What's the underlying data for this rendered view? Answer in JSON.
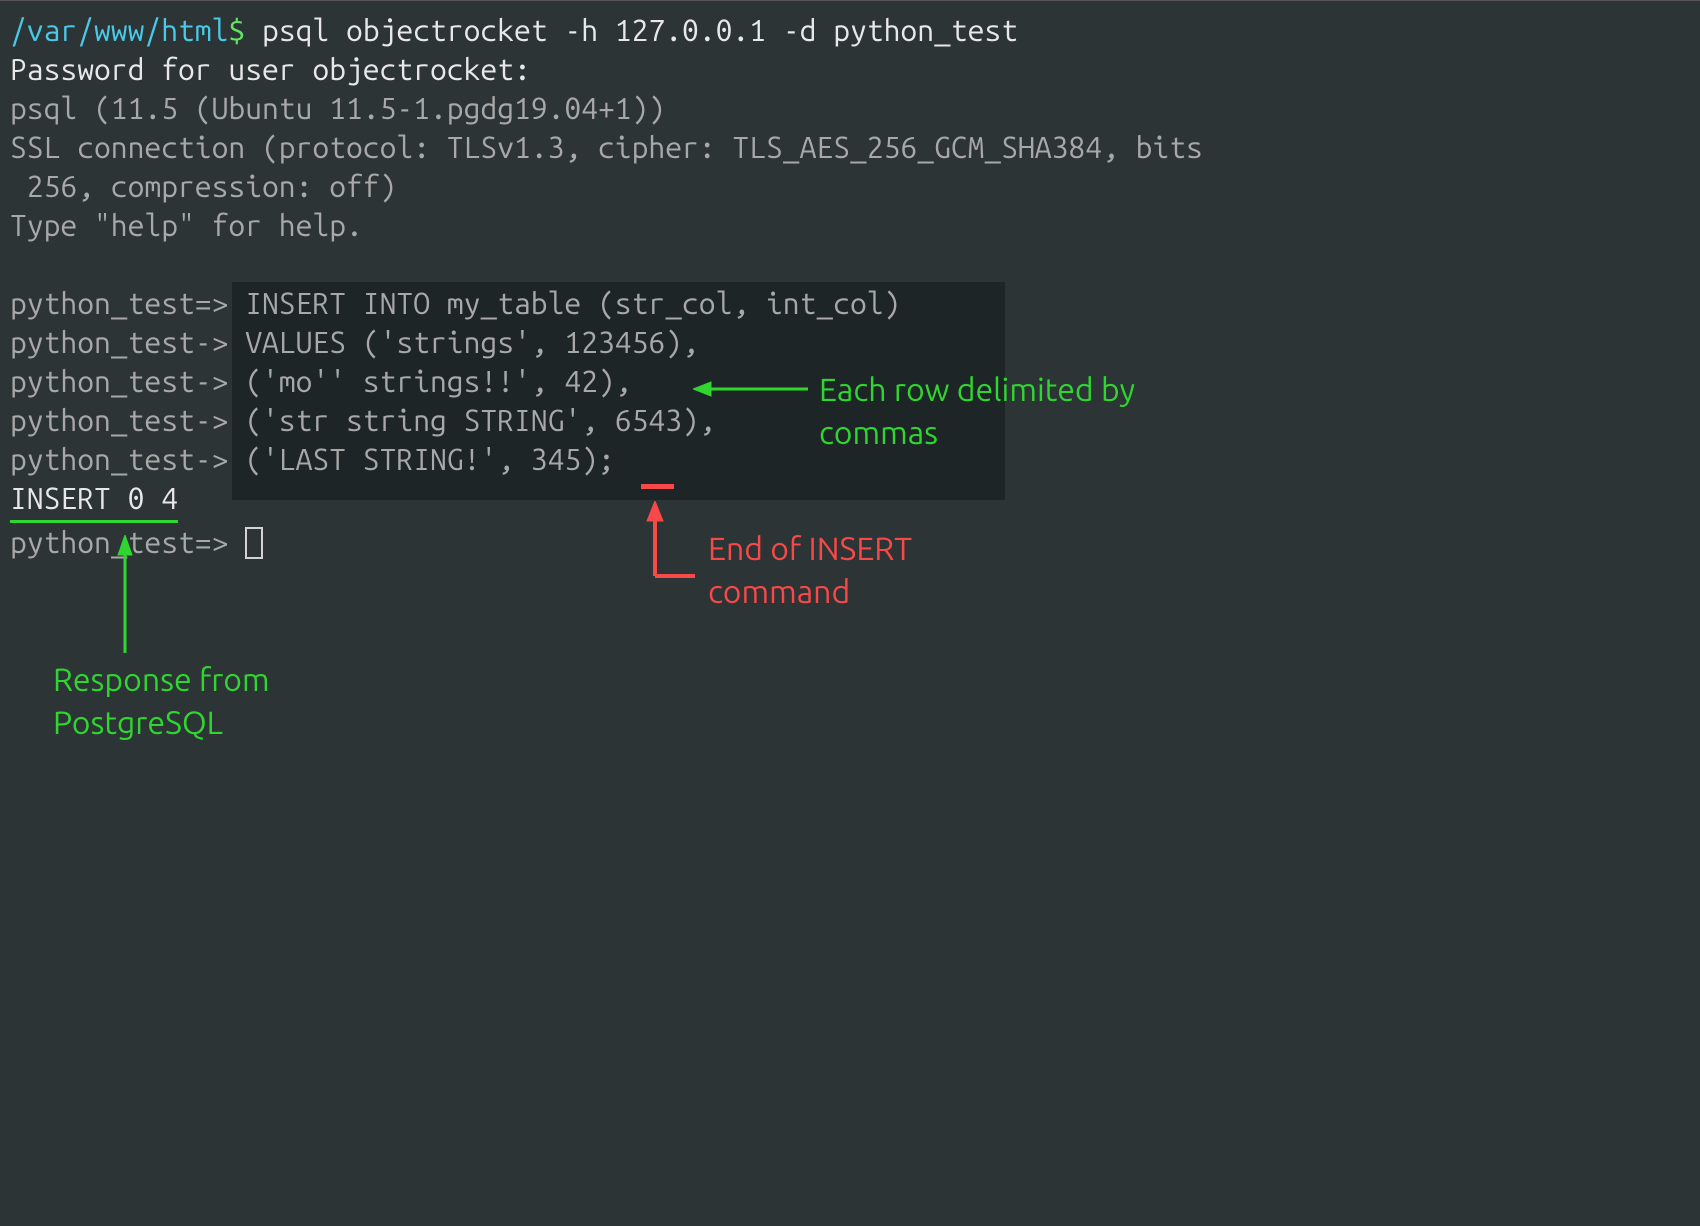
{
  "prompt": {
    "path": "/var/www/html",
    "dollar": "$",
    "command": " psql objectrocket -h 127.0.0.1 -d python_test"
  },
  "password_line": "Password for user objectrocket:",
  "psql_version": "psql (11.5 (Ubuntu 11.5-1.pgdg19.04+1))",
  "ssl_line1": "SSL connection (protocol: TLSv1.3, cipher: TLS_AES_256_GCM_SHA384, bits",
  "ssl_line2": " 256, compression: off)",
  "help_line": "Type \"help\" for help.",
  "sql": {
    "prompt1": "python_test=>",
    "prompt2": "python_test->",
    "line1": " INSERT INTO my_table (str_col, int_col)",
    "line2": " VALUES ('strings', 123456),",
    "line3": " ('mo'' strings!!', 42),",
    "line4": " ('str string STRING', 6543),",
    "line5": " ('LAST STRING!', 345);"
  },
  "insert_response": "INSERT 0 4",
  "final_prompt": "python_test=> ",
  "annotations": {
    "green_right": "Each row delimited by commas",
    "red_bottom": "End of INSERT command",
    "green_bottom": "Response from PostgreSQL"
  }
}
